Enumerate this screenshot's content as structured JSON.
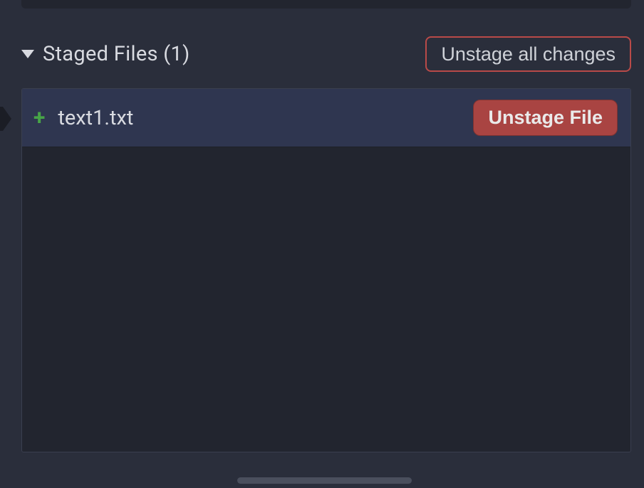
{
  "section": {
    "title": "Staged Files (1)",
    "unstage_all_label": "Unstage all changes"
  },
  "files": [
    {
      "name": "text1.txt",
      "status_icon": "plus-icon",
      "status_glyph": "+",
      "action_label": "Unstage File"
    }
  ],
  "colors": {
    "background": "#2a2e3b",
    "panel": "#22252f",
    "row_selected": "#2f3650",
    "danger_border": "#b94a48",
    "danger_fill": "#a94442",
    "added": "#47a447",
    "text": "#d8dae0"
  }
}
